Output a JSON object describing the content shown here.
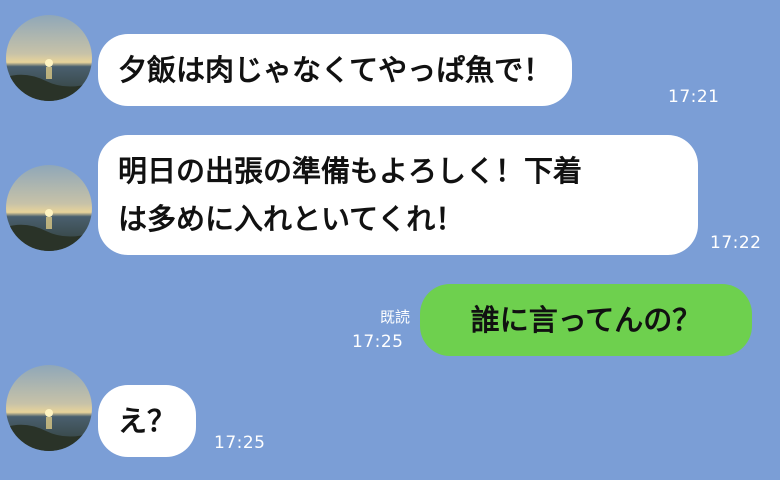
{
  "chat": {
    "messages": [
      {
        "sender": "other",
        "text": "夕飯は肉じゃなくてやっぱ魚で！",
        "time": "17:21"
      },
      {
        "sender": "other",
        "line1": "明日の出張の準備もよろしく！下着",
        "line2": "は多めに入れといてくれ！",
        "time": "17:22"
      },
      {
        "sender": "me",
        "text": "誰に言ってんの？",
        "time": "17:25",
        "read": "既読"
      },
      {
        "sender": "other",
        "text": "え？",
        "time": "17:25"
      }
    ]
  },
  "colors": {
    "background": "#7b9ed6",
    "incoming_bubble": "#ffffff",
    "outgoing_bubble": "#6ed04e"
  },
  "icons": {
    "avatar": "sunset-over-sea-avatar-icon"
  }
}
